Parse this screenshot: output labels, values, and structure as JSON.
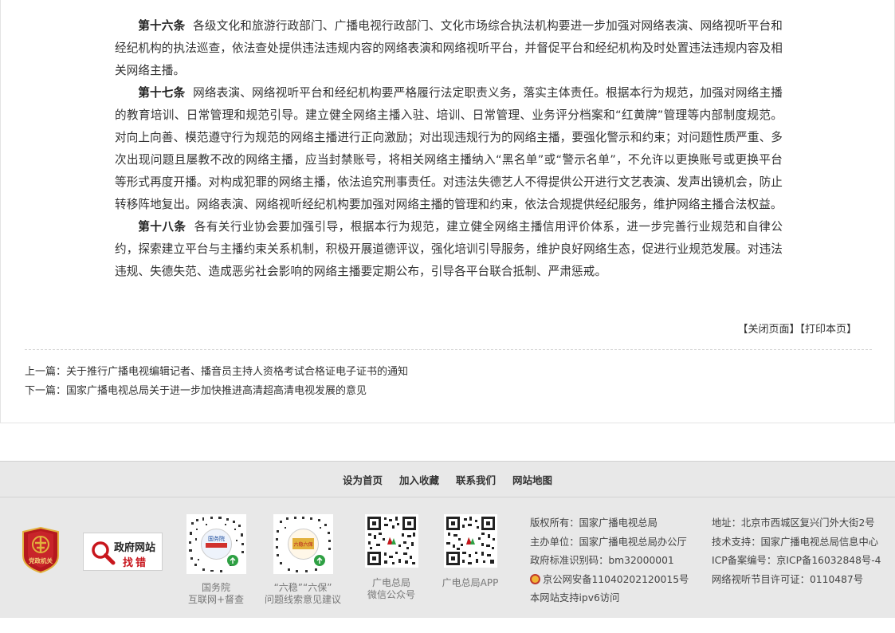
{
  "article": {
    "paragraphs": [
      {
        "heading": "第十六条",
        "text": "各级文化和旅游行政部门、广播电视行政部门、文化市场综合执法机构要进一步加强对网络表演、网络视听平台和经纪机构的执法巡查，依法查处提供违法违规内容的网络表演和网络视听平台，并督促平台和经纪机构及时处置违法违规内容及相关网络主播。"
      },
      {
        "heading": "第十七条",
        "text": "网络表演、网络视听平台和经纪机构要严格履行法定职责义务，落实主体责任。根据本行为规范，加强对网络主播的教育培训、日常管理和规范引导。建立健全网络主播入驻、培训、日常管理、业务评分档案和“红黄牌”管理等内部制度规范。对向上向善、模范遵守行为规范的网络主播进行正向激励；对出现违规行为的网络主播，要强化警示和约束；对问题性质严重、多次出现问题且屡教不改的网络主播，应当封禁账号，将相关网络主播纳入“黑名单”或“警示名单”，不允许以更换账号或更换平台等形式再度开播。对构成犯罪的网络主播，依法追究刑事责任。对违法失德艺人不得提供公开进行文艺表演、发声出镜机会，防止转移阵地复出。网络表演、网络视听经纪机构要加强对网络主播的管理和约束，依法合规提供经纪服务，维护网络主播合法权益。"
      },
      {
        "heading": "第十八条",
        "text": "各有关行业协会要加强引导，根据本行为规范，建立健全网络主播信用评价体系，进一步完善行业规范和自律公约，探索建立平台与主播约束关系机制，积极开展道德评议，强化培训引导服务，维护良好网络生态，促进行业规范发展。对违法违规、失德失范、造成恶劣社会影响的网络主播要定期公布，引导各平台联合抵制、严肃惩戒。"
      }
    ],
    "tools": {
      "close": "【关闭页面】",
      "print": "【打印本页】"
    }
  },
  "nav": {
    "prev_label": "上一篇：",
    "prev_title": "关于推行广播电视编辑记者、播音员主持人资格考试合格证电子证书的通知",
    "next_label": "下一篇：",
    "next_title": "国家广播电视总局关于进一步加快推进高清超高清电视发展的意见"
  },
  "footer": {
    "links": [
      "设为首页",
      "加入收藏",
      "联系我们",
      "网站地图"
    ],
    "badge_text": "党政机关",
    "find_error": {
      "line1": "政府网站",
      "line2": "找错"
    },
    "qrcodes": [
      {
        "caption1": "国务院",
        "caption2": "互联网+督查",
        "inner": "国务院"
      },
      {
        "caption1": "“六稳”“六保”",
        "caption2": "问题线索意见建议",
        "inner": "六稳六保"
      },
      {
        "caption1": "广电总局",
        "caption2": "微信公众号",
        "inner": ""
      },
      {
        "caption1": "广电总局APP",
        "caption2": "",
        "inner": ""
      }
    ],
    "info_left": [
      "版权所有：国家广播电视总局",
      "主办单位：国家广播电视总局办公厅",
      "政府标准识别码：bm32000001",
      "京公网安备11040202120015号",
      "本网站支持ipv6访问"
    ],
    "info_right": [
      "地址：北京市西城区复兴门外大街2号",
      "技术支持：国家广播电视总局信息中心",
      "ICP备案编号：京ICP备16032848号-4",
      "网络视听节目许可证：0110487号"
    ],
    "colors": {
      "badge_red": "#b5191e",
      "badge_gold": "#e2b13c",
      "bg": "#e8e8e8",
      "accent_red": "#c8161d",
      "qr_green": "#2ea043"
    }
  }
}
